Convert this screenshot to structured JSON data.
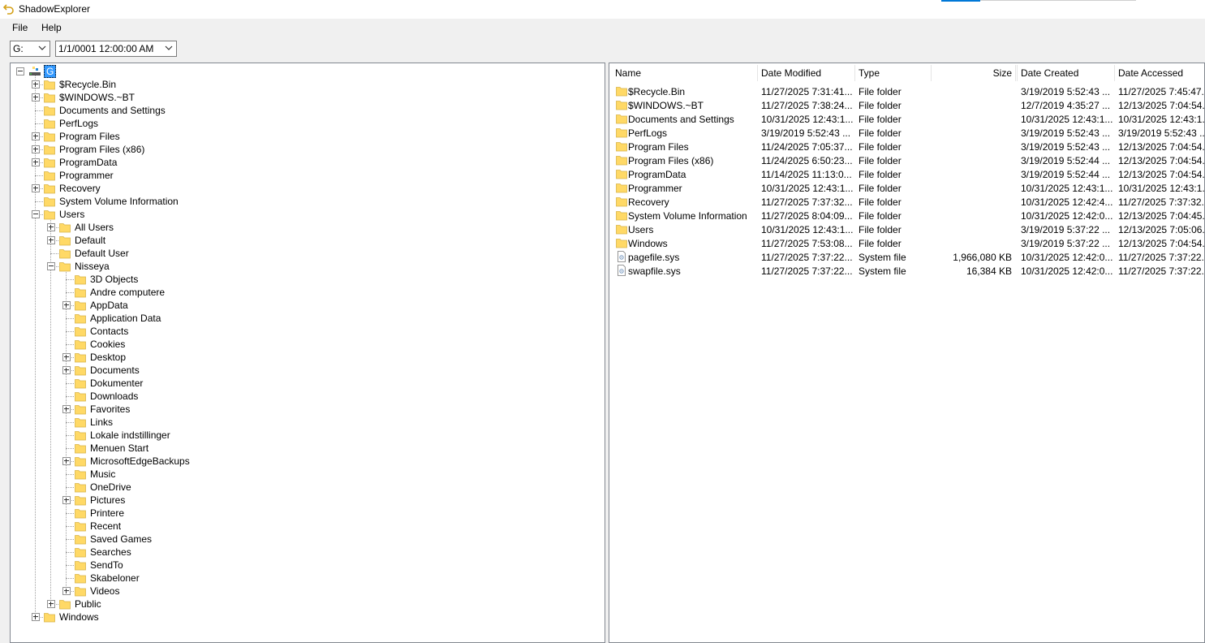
{
  "window": {
    "title": "ShadowExplorer"
  },
  "menu": [
    {
      "label": "File"
    },
    {
      "label": "Help"
    }
  ],
  "toolbar": {
    "drive": "G:",
    "snapshot": "1/1/0001 12:00:00 AM"
  },
  "colors": {
    "folder": "#ffd966",
    "selection": "#3399ff",
    "accent": "#0078d7"
  },
  "tree": [
    {
      "label": "G",
      "depth": 0,
      "exp": "minus",
      "icon": "drive-icon",
      "selected": true
    },
    {
      "label": "$Recycle.Bin",
      "depth": 1,
      "exp": "plus"
    },
    {
      "label": "$WINDOWS.~BT",
      "depth": 1,
      "exp": "plus"
    },
    {
      "label": "Documents and Settings",
      "depth": 1,
      "exp": "none"
    },
    {
      "label": "PerfLogs",
      "depth": 1,
      "exp": "none"
    },
    {
      "label": "Program Files",
      "depth": 1,
      "exp": "plus"
    },
    {
      "label": "Program Files (x86)",
      "depth": 1,
      "exp": "plus"
    },
    {
      "label": "ProgramData",
      "depth": 1,
      "exp": "plus"
    },
    {
      "label": "Programmer",
      "depth": 1,
      "exp": "none"
    },
    {
      "label": "Recovery",
      "depth": 1,
      "exp": "plus"
    },
    {
      "label": "System Volume Information",
      "depth": 1,
      "exp": "none"
    },
    {
      "label": "Users",
      "depth": 1,
      "exp": "minus"
    },
    {
      "label": "All Users",
      "depth": 2,
      "exp": "plus"
    },
    {
      "label": "Default",
      "depth": 2,
      "exp": "plus"
    },
    {
      "label": "Default User",
      "depth": 2,
      "exp": "none"
    },
    {
      "label": "Nisseya",
      "depth": 2,
      "exp": "minus"
    },
    {
      "label": "3D Objects",
      "depth": 3,
      "exp": "none"
    },
    {
      "label": "Andre computere",
      "depth": 3,
      "exp": "none"
    },
    {
      "label": "AppData",
      "depth": 3,
      "exp": "plus"
    },
    {
      "label": "Application Data",
      "depth": 3,
      "exp": "none"
    },
    {
      "label": "Contacts",
      "depth": 3,
      "exp": "none"
    },
    {
      "label": "Cookies",
      "depth": 3,
      "exp": "none"
    },
    {
      "label": "Desktop",
      "depth": 3,
      "exp": "plus"
    },
    {
      "label": "Documents",
      "depth": 3,
      "exp": "plus"
    },
    {
      "label": "Dokumenter",
      "depth": 3,
      "exp": "none"
    },
    {
      "label": "Downloads",
      "depth": 3,
      "exp": "none"
    },
    {
      "label": "Favorites",
      "depth": 3,
      "exp": "plus"
    },
    {
      "label": "Links",
      "depth": 3,
      "exp": "none"
    },
    {
      "label": "Lokale indstillinger",
      "depth": 3,
      "exp": "none"
    },
    {
      "label": "Menuen Start",
      "depth": 3,
      "exp": "none"
    },
    {
      "label": "MicrosoftEdgeBackups",
      "depth": 3,
      "exp": "plus"
    },
    {
      "label": "Music",
      "depth": 3,
      "exp": "none"
    },
    {
      "label": "OneDrive",
      "depth": 3,
      "exp": "none"
    },
    {
      "label": "Pictures",
      "depth": 3,
      "exp": "plus"
    },
    {
      "label": "Printere",
      "depth": 3,
      "exp": "none"
    },
    {
      "label": "Recent",
      "depth": 3,
      "exp": "none"
    },
    {
      "label": "Saved Games",
      "depth": 3,
      "exp": "none"
    },
    {
      "label": "Searches",
      "depth": 3,
      "exp": "none"
    },
    {
      "label": "SendTo",
      "depth": 3,
      "exp": "none"
    },
    {
      "label": "Skabeloner",
      "depth": 3,
      "exp": "none"
    },
    {
      "label": "Videos",
      "depth": 3,
      "exp": "plus"
    },
    {
      "label": "Public",
      "depth": 2,
      "exp": "plus"
    },
    {
      "label": "Windows",
      "depth": 1,
      "exp": "plus"
    }
  ],
  "columns": [
    {
      "label": "Name"
    },
    {
      "label": "Date Modified"
    },
    {
      "label": "Type"
    },
    {
      "label": "Size"
    },
    {
      "label": "Date Created"
    },
    {
      "label": "Date Accessed"
    }
  ],
  "files": [
    {
      "icon": "folder-icon",
      "name": "$Recycle.Bin",
      "modified": "11/27/2025 7:31:41...",
      "type": "File folder",
      "size": "",
      "created": "3/19/2019 5:52:43 ...",
      "accessed": "11/27/2025 7:45:47..."
    },
    {
      "icon": "folder-icon",
      "name": "$WINDOWS.~BT",
      "modified": "11/27/2025 7:38:24...",
      "type": "File folder",
      "size": "",
      "created": "12/7/2019 4:35:27 ...",
      "accessed": "12/13/2025 7:04:54..."
    },
    {
      "icon": "folder-icon",
      "name": "Documents and Settings",
      "modified": "10/31/2025 12:43:1...",
      "type": "File folder",
      "size": "",
      "created": "10/31/2025 12:43:1...",
      "accessed": "10/31/2025 12:43:1..."
    },
    {
      "icon": "folder-icon",
      "name": "PerfLogs",
      "modified": "3/19/2019 5:52:43 ...",
      "type": "File folder",
      "size": "",
      "created": "3/19/2019 5:52:43 ...",
      "accessed": "3/19/2019 5:52:43 ..."
    },
    {
      "icon": "folder-icon",
      "name": "Program Files",
      "modified": "11/24/2025 7:05:37...",
      "type": "File folder",
      "size": "",
      "created": "3/19/2019 5:52:43 ...",
      "accessed": "12/13/2025 7:04:54..."
    },
    {
      "icon": "folder-icon",
      "name": "Program Files (x86)",
      "modified": "11/24/2025 6:50:23...",
      "type": "File folder",
      "size": "",
      "created": "3/19/2019 5:52:44 ...",
      "accessed": "12/13/2025 7:04:54..."
    },
    {
      "icon": "folder-icon",
      "name": "ProgramData",
      "modified": "11/14/2025 11:13:0...",
      "type": "File folder",
      "size": "",
      "created": "3/19/2019 5:52:44 ...",
      "accessed": "12/13/2025 7:04:54..."
    },
    {
      "icon": "folder-icon",
      "name": "Programmer",
      "modified": "10/31/2025 12:43:1...",
      "type": "File folder",
      "size": "",
      "created": "10/31/2025 12:43:1...",
      "accessed": "10/31/2025 12:43:1..."
    },
    {
      "icon": "folder-icon",
      "name": "Recovery",
      "modified": "11/27/2025 7:37:32...",
      "type": "File folder",
      "size": "",
      "created": "10/31/2025 12:42:4...",
      "accessed": "11/27/2025 7:37:32..."
    },
    {
      "icon": "folder-icon",
      "name": "System Volume Information",
      "modified": "11/27/2025 8:04:09...",
      "type": "File folder",
      "size": "",
      "created": "10/31/2025 12:42:0...",
      "accessed": "12/13/2025 7:04:45..."
    },
    {
      "icon": "folder-icon",
      "name": "Users",
      "modified": "10/31/2025 12:43:1...",
      "type": "File folder",
      "size": "",
      "created": "3/19/2019 5:37:22 ...",
      "accessed": "12/13/2025 7:05:06..."
    },
    {
      "icon": "folder-icon",
      "name": "Windows",
      "modified": "11/27/2025 7:53:08...",
      "type": "File folder",
      "size": "",
      "created": "3/19/2019 5:37:22 ...",
      "accessed": "12/13/2025 7:04:54..."
    },
    {
      "icon": "system-file-icon",
      "name": "pagefile.sys",
      "modified": "11/27/2025 7:37:22...",
      "type": "System file",
      "size": "1,966,080 KB",
      "created": "10/31/2025 12:42:0...",
      "accessed": "11/27/2025 7:37:22..."
    },
    {
      "icon": "system-file-icon",
      "name": "swapfile.sys",
      "modified": "11/27/2025 7:37:22...",
      "type": "System file",
      "size": "16,384 KB",
      "created": "10/31/2025 12:42:0...",
      "accessed": "11/27/2025 7:37:22..."
    }
  ]
}
